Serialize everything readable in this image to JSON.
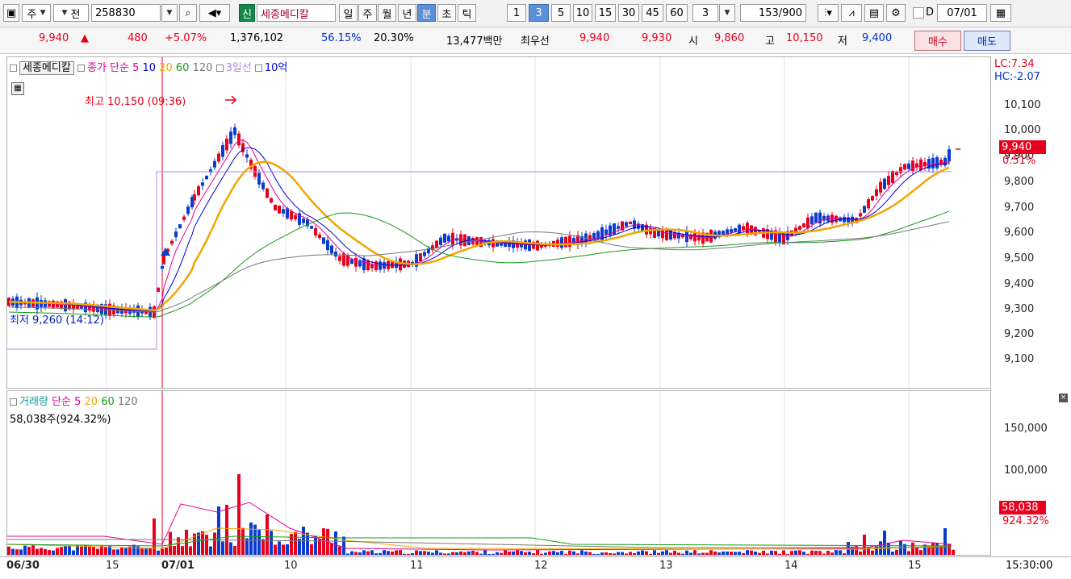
{
  "toolbar": {
    "market_sel": "주",
    "prev_label": "전",
    "code": "258830",
    "new_badge": "신",
    "stock_name": "세종메디칼",
    "periods": [
      "일",
      "주",
      "월",
      "년",
      "분",
      "초",
      "틱"
    ],
    "active_period": "분",
    "intervals": [
      "1",
      "3",
      "5",
      "10",
      "15",
      "30",
      "45",
      "60"
    ],
    "active_interval": "3",
    "count_value": "3",
    "page_count": "153",
    "page_total": "/900",
    "date_value": "07/01",
    "date_prefix": "D"
  },
  "quote": {
    "price": "9,940",
    "change_arrow": "▲",
    "change": "480",
    "change_pct": "+5.07%",
    "volume": "1,376,102",
    "ratio1": "56.15%",
    "ratio2": "20.30%",
    "amount": "13,477백만",
    "best_label": "최우선",
    "ask": "9,940",
    "bid": "9,930",
    "open_label": "시",
    "open": "9,860",
    "high_label": "고",
    "high": "10,150",
    "low_label": "저",
    "low": "9,400",
    "buy_label": "매수",
    "sell_label": "매도"
  },
  "price_pane": {
    "legend": {
      "name": "세종메디칼",
      "close_label": "종가",
      "ma_label": "단순",
      "ma_periods": [
        "5",
        "10",
        "20",
        "60",
        "120"
      ],
      "line3": "3일선",
      "amount_label": "10억"
    },
    "lc": "LC:7.34",
    "hc": "HC:-2.07",
    "y_ticks": [
      "10,100",
      "10,000",
      "9,900",
      "9,800",
      "9,700",
      "9,600",
      "9,500",
      "9,400",
      "9,300",
      "9,200",
      "9,100"
    ],
    "current_tag": "9,940",
    "current_pct": "0.51%",
    "high_note": "최고 10,150 (09:36)",
    "low_note": "최저 9,260 (14:12)"
  },
  "volume_pane": {
    "legend": {
      "name": "거래량",
      "ma_label": "단순",
      "ma_periods": [
        "5",
        "20",
        "60",
        "120"
      ]
    },
    "info": "58,038주(924.32%)",
    "y_ticks": [
      "150,000",
      "100,000"
    ],
    "current_tag": "58,038",
    "current_pct": "924.32%"
  },
  "x_axis": {
    "labels": [
      "06/30",
      "15",
      "07/01",
      "10",
      "11",
      "12",
      "13",
      "14",
      "15"
    ],
    "time": "15:30:00"
  },
  "colors": {
    "up": "#e8001c",
    "down": "#0a3cd0",
    "ma5": "#e60099",
    "ma10": "#0000dd",
    "ma20": "#f0a800",
    "ma60": "#189a18",
    "ma120": "#777777",
    "line3": "#b088e8"
  }
}
